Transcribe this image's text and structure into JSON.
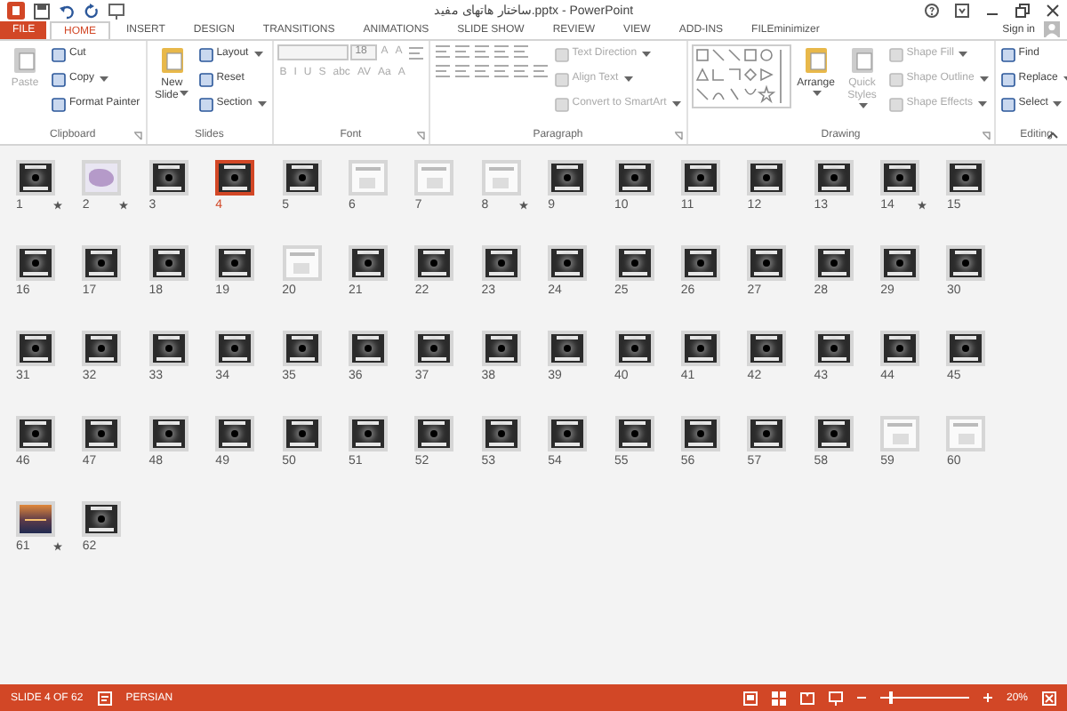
{
  "window": {
    "title": "ساختار هاتهای مفید.pptx - PowerPoint",
    "sign_in": "Sign in"
  },
  "tabs": [
    {
      "label": "FILE",
      "kind": "file",
      "selected": false
    },
    {
      "label": "HOME",
      "kind": "tab",
      "selected": true
    },
    {
      "label": "INSERT",
      "kind": "tab",
      "selected": false
    },
    {
      "label": "DESIGN",
      "kind": "tab",
      "selected": false
    },
    {
      "label": "TRANSITIONS",
      "kind": "tab",
      "selected": false
    },
    {
      "label": "ANIMATIONS",
      "kind": "tab",
      "selected": false
    },
    {
      "label": "SLIDE SHOW",
      "kind": "tab",
      "selected": false
    },
    {
      "label": "REVIEW",
      "kind": "tab",
      "selected": false
    },
    {
      "label": "VIEW",
      "kind": "tab",
      "selected": false
    },
    {
      "label": "ADD-INS",
      "kind": "tab",
      "selected": false
    },
    {
      "label": "FILEminimizer",
      "kind": "tab",
      "selected": false
    }
  ],
  "ribbon": {
    "groups": [
      {
        "label": "Clipboard",
        "launcher": true,
        "columns": [
          [
            [
              {
                "kind": "large",
                "label": "Paste",
                "dropdown": false,
                "disabled": true
              }
            ]
          ],
          [
            [
              {
                "kind": "small",
                "label": "Cut",
                "dropdown": false,
                "disabled": false
              }
            ],
            [
              {
                "kind": "small",
                "label": "Copy",
                "dropdown": true,
                "disabled": false
              }
            ],
            [
              {
                "kind": "small",
                "label": "Format Painter",
                "dropdown": false,
                "disabled": false
              }
            ]
          ]
        ]
      },
      {
        "label": "Slides",
        "launcher": false,
        "columns": [
          [
            [
              {
                "kind": "large",
                "label": "New Slide",
                "dropdown": true,
                "disabled": false
              }
            ]
          ],
          [
            [
              {
                "kind": "small",
                "label": "Layout",
                "dropdown": true,
                "disabled": false
              }
            ],
            [
              {
                "kind": "small",
                "label": "Reset",
                "dropdown": false,
                "disabled": false
              }
            ],
            [
              {
                "kind": "small",
                "label": "Section",
                "dropdown": true,
                "disabled": false
              }
            ]
          ]
        ]
      },
      {
        "label": "Font",
        "launcher": true,
        "columns": [
          [
            [
              {
                "kind": "field",
                "disabled": true
              },
              {
                "kind": "size",
                "label": "18",
                "disabled": true
              },
              {
                "kind": "glyph",
                "label": "A",
                "disabled": true
              },
              {
                "kind": "glyph",
                "label": "A",
                "disabled": true
              },
              {
                "kind": "icon",
                "disabled": true
              }
            ],
            [
              {
                "kind": "glyph",
                "label": "B",
                "disabled": true
              },
              {
                "kind": "glyph",
                "label": "I",
                "disabled": true
              },
              {
                "kind": "glyph",
                "label": "U",
                "disabled": true
              },
              {
                "kind": "glyph",
                "label": "S",
                "disabled": true
              },
              {
                "kind": "glyph",
                "label": "abc",
                "disabled": true
              },
              {
                "kind": "glyph",
                "label": "AV",
                "disabled": true
              },
              {
                "kind": "glyph",
                "label": "Aa",
                "disabled": true
              },
              {
                "kind": "glyph",
                "label": "A",
                "disabled": true
              }
            ]
          ]
        ]
      },
      {
        "label": "Paragraph",
        "launcher": true,
        "columns": [
          [
            [
              {
                "kind": "icon",
                "disabled": true
              },
              {
                "kind": "icon",
                "disabled": true
              },
              {
                "kind": "icon",
                "disabled": true
              },
              {
                "kind": "icon",
                "disabled": true
              },
              {
                "kind": "icon",
                "disabled": true
              }
            ],
            [
              {
                "kind": "icon",
                "disabled": true
              },
              {
                "kind": "icon",
                "disabled": true
              },
              {
                "kind": "icon",
                "disabled": true
              },
              {
                "kind": "icon",
                "disabled": true
              },
              {
                "kind": "icon",
                "disabled": true
              },
              {
                "kind": "icon",
                "disabled": true
              }
            ]
          ],
          [
            [
              {
                "kind": "small",
                "label": "Text Direction",
                "dropdown": true,
                "disabled": true
              }
            ],
            [
              {
                "kind": "small",
                "label": "Align Text",
                "dropdown": true,
                "disabled": true
              }
            ],
            [
              {
                "kind": "small",
                "label": "Convert to SmartArt",
                "dropdown": true,
                "disabled": true
              }
            ]
          ]
        ]
      },
      {
        "label": "Drawing",
        "launcher": true,
        "columns": [
          [
            [
              {
                "kind": "gallery",
                "disabled": true
              }
            ]
          ],
          [
            [
              {
                "kind": "large",
                "label": "Arrange",
                "dropdown": true,
                "disabled": false
              }
            ]
          ],
          [
            [
              {
                "kind": "large",
                "label": "Quick Styles",
                "dropdown": true,
                "disabled": true
              }
            ]
          ],
          [
            [
              {
                "kind": "small",
                "label": "Shape Fill",
                "dropdown": true,
                "disabled": true
              }
            ],
            [
              {
                "kind": "small",
                "label": "Shape Outline",
                "dropdown": true,
                "disabled": true
              }
            ],
            [
              {
                "kind": "small",
                "label": "Shape Effects",
                "dropdown": true,
                "disabled": true
              }
            ]
          ]
        ]
      },
      {
        "label": "Editing",
        "launcher": false,
        "columns": [
          [
            [
              {
                "kind": "small",
                "label": "Find",
                "dropdown": false,
                "disabled": false
              }
            ],
            [
              {
                "kind": "small",
                "label": "Replace",
                "dropdown": true,
                "disabled": false
              }
            ],
            [
              {
                "kind": "small",
                "label": "Select",
                "dropdown": true,
                "disabled": false
              }
            ]
          ]
        ]
      }
    ]
  },
  "slides": [
    {
      "number": "1",
      "star": true,
      "kind": "dark",
      "selected": false
    },
    {
      "number": "2",
      "star": true,
      "kind": "map",
      "selected": false
    },
    {
      "number": "3",
      "star": false,
      "kind": "dark",
      "selected": false
    },
    {
      "number": "4",
      "star": false,
      "kind": "dark",
      "selected": true
    },
    {
      "number": "5",
      "star": false,
      "kind": "dark",
      "selected": false
    },
    {
      "number": "6",
      "star": false,
      "kind": "light",
      "selected": false
    },
    {
      "number": "7",
      "star": false,
      "kind": "light",
      "selected": false
    },
    {
      "number": "8",
      "star": true,
      "kind": "light",
      "selected": false
    },
    {
      "number": "9",
      "star": false,
      "kind": "dark",
      "selected": false
    },
    {
      "number": "10",
      "star": false,
      "kind": "dark",
      "selected": false
    },
    {
      "number": "11",
      "star": false,
      "kind": "dark",
      "selected": false
    },
    {
      "number": "12",
      "star": false,
      "kind": "dark",
      "selected": false
    },
    {
      "number": "13",
      "star": false,
      "kind": "dark",
      "selected": false
    },
    {
      "number": "14",
      "star": true,
      "kind": "dark",
      "selected": false
    },
    {
      "number": "15",
      "star": false,
      "kind": "dark",
      "selected": false
    },
    {
      "number": "16",
      "star": false,
      "kind": "dark",
      "selected": false
    },
    {
      "number": "17",
      "star": false,
      "kind": "dark",
      "selected": false
    },
    {
      "number": "18",
      "star": false,
      "kind": "dark",
      "selected": false
    },
    {
      "number": "19",
      "star": false,
      "kind": "dark",
      "selected": false
    },
    {
      "number": "20",
      "star": false,
      "kind": "light",
      "selected": false
    },
    {
      "number": "21",
      "star": false,
      "kind": "dark",
      "selected": false
    },
    {
      "number": "22",
      "star": false,
      "kind": "dark",
      "selected": false
    },
    {
      "number": "23",
      "star": false,
      "kind": "dark",
      "selected": false
    },
    {
      "number": "24",
      "star": false,
      "kind": "dark",
      "selected": false
    },
    {
      "number": "25",
      "star": false,
      "kind": "dark",
      "selected": false
    },
    {
      "number": "26",
      "star": false,
      "kind": "dark",
      "selected": false
    },
    {
      "number": "27",
      "star": false,
      "kind": "dark",
      "selected": false
    },
    {
      "number": "28",
      "star": false,
      "kind": "dark",
      "selected": false
    },
    {
      "number": "29",
      "star": false,
      "kind": "dark",
      "selected": false
    },
    {
      "number": "30",
      "star": false,
      "kind": "dark",
      "selected": false
    },
    {
      "number": "31",
      "star": false,
      "kind": "dark",
      "selected": false
    },
    {
      "number": "32",
      "star": false,
      "kind": "dark",
      "selected": false
    },
    {
      "number": "33",
      "star": false,
      "kind": "dark",
      "selected": false
    },
    {
      "number": "34",
      "star": false,
      "kind": "dark",
      "selected": false
    },
    {
      "number": "35",
      "star": false,
      "kind": "dark",
      "selected": false
    },
    {
      "number": "36",
      "star": false,
      "kind": "dark",
      "selected": false
    },
    {
      "number": "37",
      "star": false,
      "kind": "dark",
      "selected": false
    },
    {
      "number": "38",
      "star": false,
      "kind": "dark",
      "selected": false
    },
    {
      "number": "39",
      "star": false,
      "kind": "dark",
      "selected": false
    },
    {
      "number": "40",
      "star": false,
      "kind": "dark",
      "selected": false
    },
    {
      "number": "41",
      "star": false,
      "kind": "dark",
      "selected": false
    },
    {
      "number": "42",
      "star": false,
      "kind": "dark",
      "selected": false
    },
    {
      "number": "43",
      "star": false,
      "kind": "dark",
      "selected": false
    },
    {
      "number": "44",
      "star": false,
      "kind": "dark",
      "selected": false
    },
    {
      "number": "45",
      "star": false,
      "kind": "dark",
      "selected": false
    },
    {
      "number": "46",
      "star": false,
      "kind": "dark",
      "selected": false
    },
    {
      "number": "47",
      "star": false,
      "kind": "dark",
      "selected": false
    },
    {
      "number": "48",
      "star": false,
      "kind": "dark",
      "selected": false
    },
    {
      "number": "49",
      "star": false,
      "kind": "dark",
      "selected": false
    },
    {
      "number": "50",
      "star": false,
      "kind": "dark",
      "selected": false
    },
    {
      "number": "51",
      "star": false,
      "kind": "dark",
      "selected": false
    },
    {
      "number": "52",
      "star": false,
      "kind": "dark",
      "selected": false
    },
    {
      "number": "53",
      "star": false,
      "kind": "dark",
      "selected": false
    },
    {
      "number": "54",
      "star": false,
      "kind": "dark",
      "selected": false
    },
    {
      "number": "55",
      "star": false,
      "kind": "dark",
      "selected": false
    },
    {
      "number": "56",
      "star": false,
      "kind": "dark",
      "selected": false
    },
    {
      "number": "57",
      "star": false,
      "kind": "dark",
      "selected": false
    },
    {
      "number": "58",
      "star": false,
      "kind": "dark",
      "selected": false
    },
    {
      "number": "59",
      "star": false,
      "kind": "light",
      "selected": false
    },
    {
      "number": "60",
      "star": false,
      "kind": "light",
      "selected": false
    },
    {
      "number": "61",
      "star": true,
      "kind": "photo",
      "selected": false
    },
    {
      "number": "62",
      "star": false,
      "kind": "dark",
      "selected": false
    }
  ],
  "status_bar": {
    "slide": "SLIDE 4 OF 62",
    "language": "PERSIAN",
    "zoom": "20%",
    "zoom_slider": {
      "level": 0.1
    }
  }
}
